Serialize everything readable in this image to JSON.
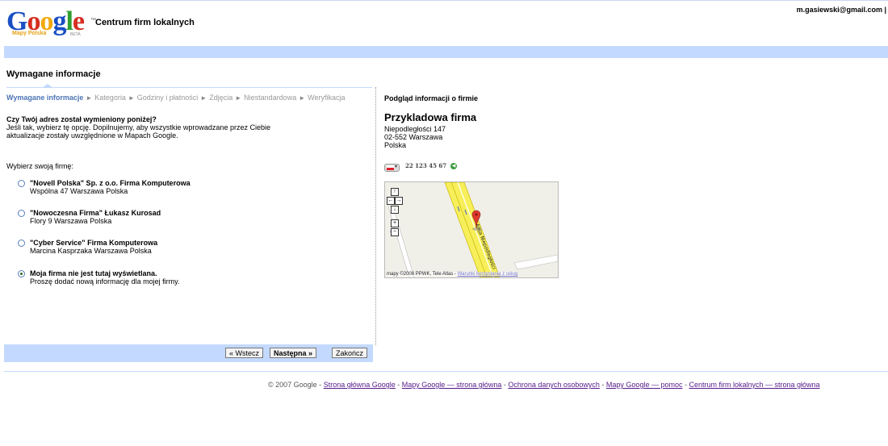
{
  "header": {
    "logo_text": "Google",
    "logo_tm": "™",
    "logo_subtitle": "Mapy Polska",
    "logo_beta": "BETA",
    "app_title": "Centrum firm lokalnych",
    "user_email": "m.gasiewski@gmail.com |"
  },
  "section": {
    "title": "Wymagane informacje"
  },
  "steps": [
    {
      "label": "Wymagane informacje",
      "active": true
    },
    {
      "label": "Kategoria",
      "active": false
    },
    {
      "label": "Godziny i płatności",
      "active": false
    },
    {
      "label": "Zdjęcia",
      "active": false
    },
    {
      "label": "Niestandardowa",
      "active": false
    },
    {
      "label": "Weryfikacja",
      "active": false
    }
  ],
  "step_arrow": "►",
  "question": {
    "heading": "Czy Twój adres został wymieniony poniżej?",
    "line1": "Jeśli tak, wybierz tę opcję. Dopilnujemy, aby wszystkie wprowadzane przez Ciebie",
    "line2": "aktualizacje zostały uwzględnione w Mapach Google."
  },
  "choose_label": "Wybierz swoją firmę:",
  "options": [
    {
      "name": "\"Novell Polska\" Sp. z o.o. Firma Komputerowa",
      "detail": "Wspólna 47 Warszawa Polska",
      "selected": false
    },
    {
      "name": "\"Nowoczesna Firma\" Łukasz Kurosad",
      "detail": "Flory 9 Warszawa Polska",
      "selected": false
    },
    {
      "name": "\"Cyber Service\" Firma Komputerowa",
      "detail": "Marcina Kasprzaka Warszawa Polska",
      "selected": false
    },
    {
      "name": "Moja firma nie jest tutaj wyświetlana.",
      "detail": "Proszę dodać nową informację dla mojej firmy.",
      "selected": true
    }
  ],
  "buttons": {
    "back": "« Wstecz",
    "next": "Następna »",
    "finish": "Zakończ"
  },
  "preview": {
    "title": "Podgląd informacji o firmie",
    "business_name": "Przykladowa firma",
    "address_line1": "Niepodległości 147",
    "address_line2": "02-552 Warszawa",
    "address_line3": "Polska",
    "phone": "22 123 45 67",
    "phone_flag_icon": "poland-flag-icon",
    "call_icon": "call-icon"
  },
  "map": {
    "street_label": "Aleja Niepodległości",
    "copyright": "mapy ©2008 PPWK, Tele Atlas -",
    "terms_link": "Warunki korzystania z usług",
    "controls": {
      "pan_up": "↑",
      "pan_left": "←",
      "pan_right": "→",
      "pan_down": "↓",
      "zoom_in": "+",
      "zoom_out": "−"
    }
  },
  "footer": {
    "copyright": "© 2007 Google -",
    "sep": " - ",
    "links": [
      "Strona główna Google",
      "Mapy Google — strona główna",
      "Ochrona danych osobowych",
      "Mapy Google — pomoc",
      "Centrum firm lokalnych — strona główna"
    ]
  },
  "colors": {
    "accent_blue": "#c3d9ff",
    "active_step": "#4c74b5",
    "road_yellow": "#f7ef5a",
    "link_purple": "#551a8b"
  }
}
